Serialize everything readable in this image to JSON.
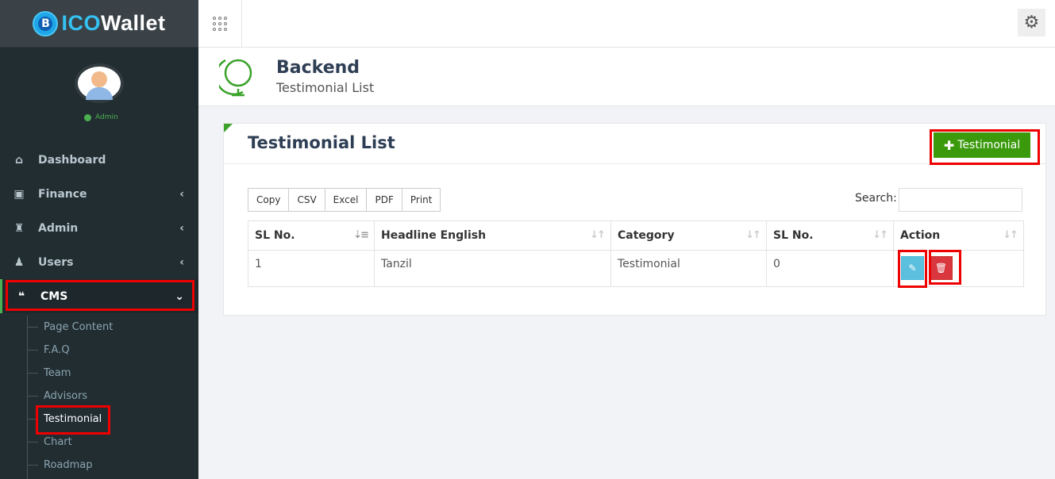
{
  "brand": {
    "ico": "ICO",
    "wallet": "Wallet",
    "mark": "B"
  },
  "user": {
    "role": "Admin"
  },
  "sidebar": {
    "items": [
      {
        "label": "Dashboard",
        "icon": "home-icon",
        "glyph": "⌂",
        "chevron": ""
      },
      {
        "label": "Finance",
        "icon": "money-icon",
        "glyph": "▣",
        "chevron": "‹"
      },
      {
        "label": "Admin",
        "icon": "user-secret-icon",
        "glyph": "♜",
        "chevron": "‹"
      },
      {
        "label": "Users",
        "icon": "users-icon",
        "glyph": "♟",
        "chevron": "‹"
      },
      {
        "label": "CMS",
        "icon": "comments-icon",
        "glyph": "❝",
        "chevron": "⌄"
      }
    ],
    "submenu": [
      {
        "label": "Page Content"
      },
      {
        "label": "F.A.Q"
      },
      {
        "label": "Team"
      },
      {
        "label": "Advisors"
      },
      {
        "label": "Testimonial"
      },
      {
        "label": "Chart"
      },
      {
        "label": "Roadmap"
      }
    ]
  },
  "header": {
    "title": "Backend",
    "subtitle": "Testimonial List"
  },
  "panel": {
    "title": "Testimonial List",
    "add_label": "Testimonial",
    "export_buttons": [
      "Copy",
      "CSV",
      "Excel",
      "PDF",
      "Print"
    ],
    "search_label": "Search:",
    "search_value": ""
  },
  "table": {
    "columns": [
      "SL No.",
      "Headline English",
      "Category",
      "SL No.",
      "Action"
    ],
    "rows": [
      {
        "sl": "1",
        "headline": "Tanzil",
        "category": "Testimonial",
        "sl_no": "0"
      }
    ]
  },
  "colors": {
    "sidebar_bg": "#222d32",
    "accent_green": "#3a9a0c",
    "edit_blue": "#5bc0de",
    "delete_red": "#d9363e",
    "highlight_red": "#e00000"
  }
}
